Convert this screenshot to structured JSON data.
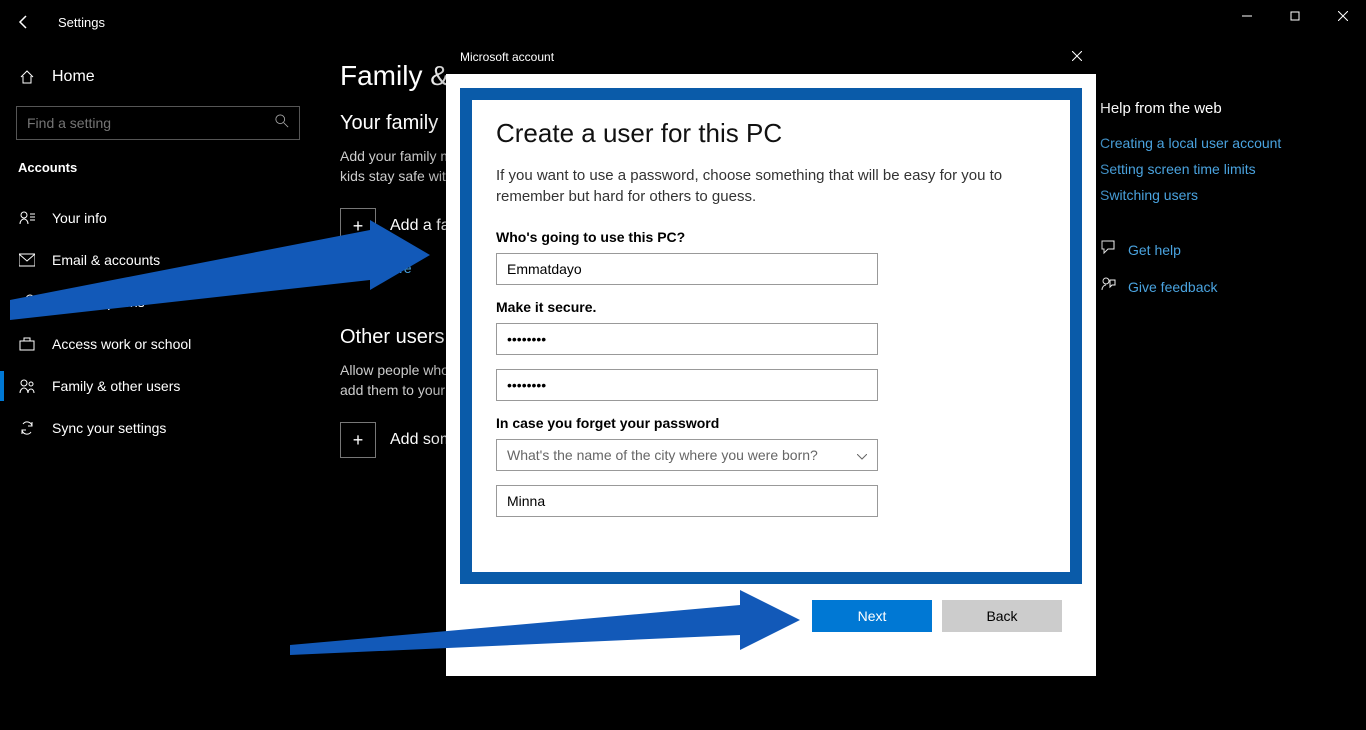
{
  "window": {
    "app": "Settings"
  },
  "sidebar": {
    "home": "Home",
    "search_placeholder": "Find a setting",
    "section": "Accounts",
    "items": [
      {
        "icon": "user",
        "label": "Your info"
      },
      {
        "icon": "mail",
        "label": "Email & accounts"
      },
      {
        "icon": "key",
        "label": "Sign-in options"
      },
      {
        "icon": "briefcase",
        "label": "Access work or school"
      },
      {
        "icon": "family",
        "label": "Family & other users"
      },
      {
        "icon": "sync",
        "label": "Sync your settings"
      }
    ]
  },
  "main": {
    "title": "Family & other users",
    "family_heading": "Your family",
    "family_desc": "Add your family members so everyone gets their own sign-in and desktop. You can help kids stay safe with appropriate websites, time limits, apps, and games.",
    "add_family": "Add a family member",
    "learn_more": "Learn more",
    "others_heading": "Other users",
    "others_desc": "Allow people who are not part of your family to sign in with their own accounts. This won't add them to your family.",
    "add_other": "Add someone else to this PC"
  },
  "help": {
    "title": "Help from the web",
    "links": [
      "Creating a local user account",
      "Setting screen time limits",
      "Switching users"
    ],
    "get_help": "Get help",
    "give_feedback": "Give feedback"
  },
  "dialog": {
    "title": "Microsoft account",
    "heading": "Create a user for this PC",
    "desc": "If you want to use a password, choose something that will be easy for you to remember but hard for others to guess.",
    "q1": "Who's going to use this PC?",
    "username": "Emmatdayo",
    "q2": "Make it secure.",
    "password": "••••••••",
    "confirm": "••••••••",
    "q3": "In case you forget your password",
    "security_question": "What's the name of the city where you were born?",
    "answer": "Minna",
    "next": "Next",
    "back": "Back"
  }
}
